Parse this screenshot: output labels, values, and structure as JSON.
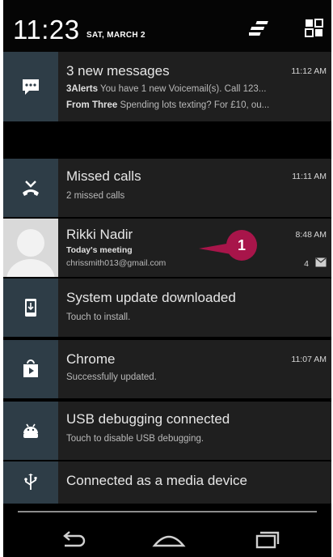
{
  "status_bar": {
    "time": "11:23",
    "date": "SAT, MARCH 2"
  },
  "notifications": [
    {
      "title": "3 new messages",
      "time": "11:12 AM",
      "icon": "chat-icon",
      "lines": [
        {
          "label": "3Alerts",
          "text": "You have 1 new Voicemail(s). Call 123..."
        },
        {
          "label": "From Three",
          "text": "Spending lots texting? For £10, ou..."
        }
      ]
    },
    {
      "title": "Missed calls",
      "time": "11:11 AM",
      "icon": "missed-call-icon",
      "subtitle": "2 missed calls"
    },
    {
      "title": "Rikki Nadir",
      "time": "8:48 AM",
      "icon": "contact-avatar",
      "subject": "Today's meeting",
      "account": "chrissmith013@gmail.com",
      "count": "4"
    },
    {
      "title": "System update downloaded",
      "icon": "system-update-icon",
      "subtitle": "Touch to install."
    },
    {
      "title": "Chrome",
      "time": "11:07 AM",
      "icon": "play-store-icon",
      "subtitle": "Successfully updated."
    },
    {
      "title": "USB debugging connected",
      "icon": "android-icon",
      "subtitle": "Touch to disable USB debugging."
    },
    {
      "title": "Connected as a media device",
      "icon": "usb-icon"
    }
  ],
  "callout": {
    "number": "1",
    "color": "#a8154a"
  },
  "colors": {
    "icon_panel": "#2e3d47",
    "item_background": "#1f1f1f"
  }
}
